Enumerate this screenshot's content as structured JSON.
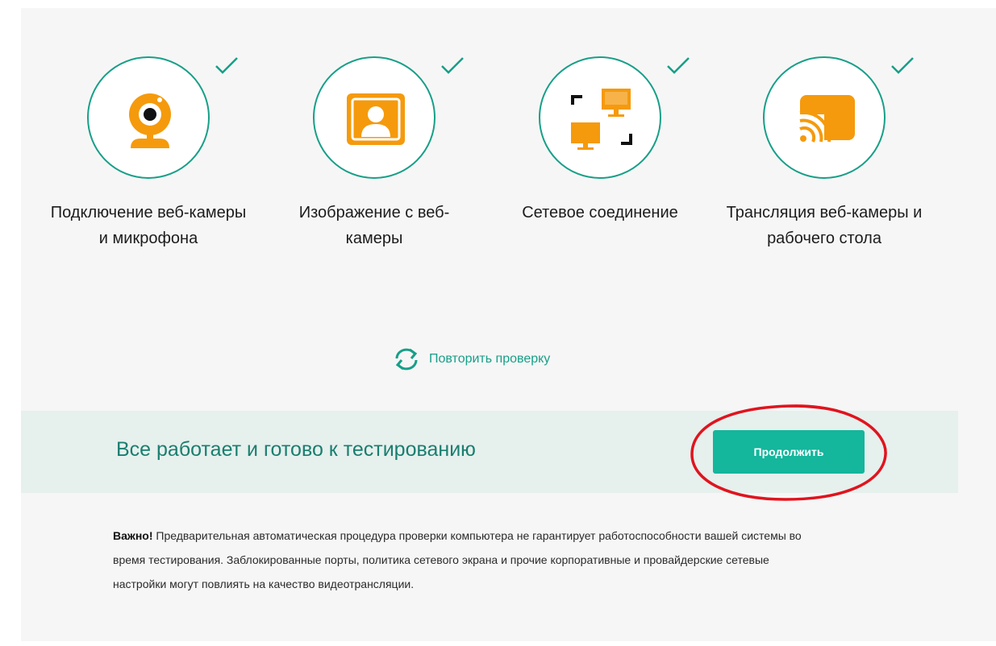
{
  "checks": [
    {
      "label": "Подключение веб-камеры и микрофона",
      "icon": "webcam-icon",
      "status": "passed"
    },
    {
      "label": "Изображение с веб-камеры",
      "icon": "user-portrait-icon",
      "status": "passed"
    },
    {
      "label": "Сетевое соединение",
      "icon": "network-monitors-icon",
      "status": "passed"
    },
    {
      "label": "Трансляция веб-камеры и рабочего стола",
      "icon": "cast-screen-icon",
      "status": "passed"
    }
  ],
  "retry": {
    "label": "Повторить проверку",
    "icon": "refresh-icon"
  },
  "status": {
    "message": "Все работает и готово к тестированию",
    "continue_label": "Продолжить"
  },
  "note": {
    "bold": "Важно!",
    "text": " Предварительная автоматическая процедура проверки компьютера не гарантирует работоспособности вашей системы во время тестирования. Заблокированные порты, политика сетевого экрана и прочие корпоративные и провайдерские сетевые настройки могут повлиять на качество видеотрансляции."
  },
  "colors": {
    "accent": "#179f88",
    "button": "#14b69c",
    "icon_orange": "#f59a0c",
    "status_bg": "#e6f0ed",
    "annotation_red": "#e0141e"
  }
}
